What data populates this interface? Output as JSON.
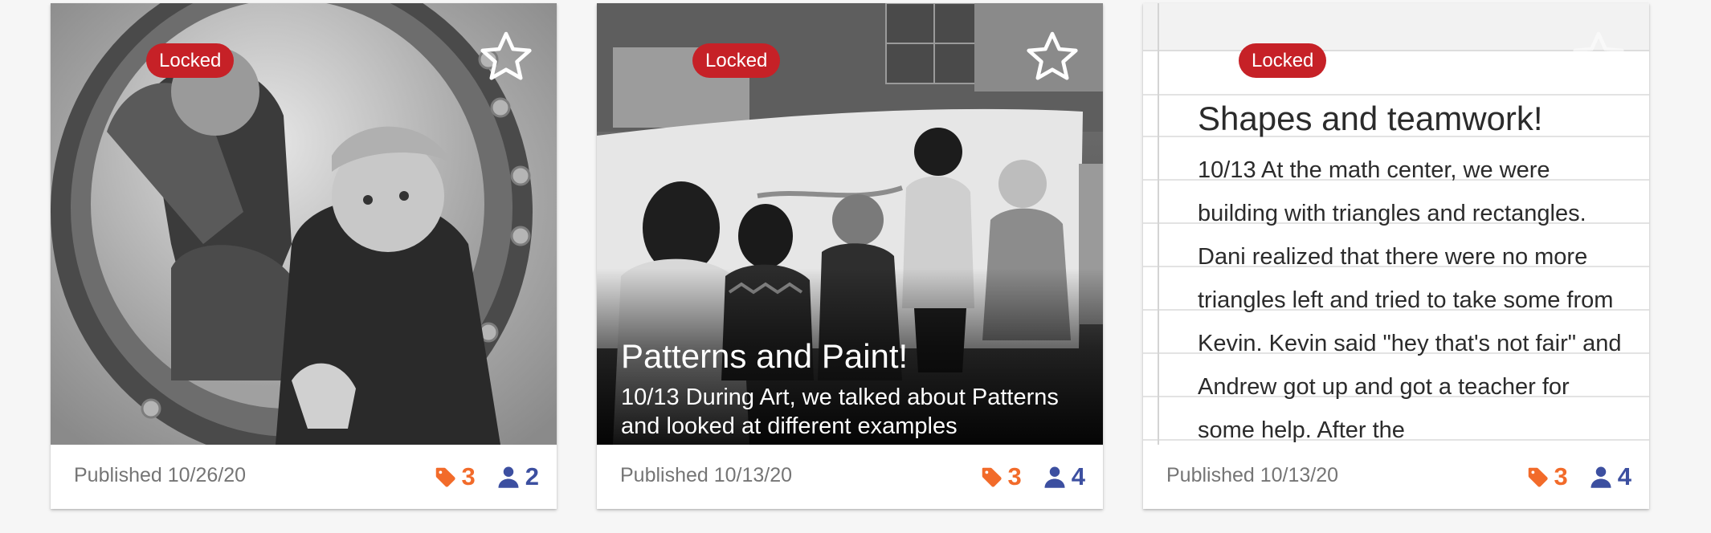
{
  "colors": {
    "locked_badge": "#c62127",
    "tag_accent": "#f26b2a",
    "people_accent": "#3c4fa0",
    "published_text": "#757575"
  },
  "cards": [
    {
      "locked_label": "Locked",
      "star_icon": "star-outline-icon",
      "published": "Published 10/26/20",
      "tag_count": "3",
      "people_count": "2"
    },
    {
      "locked_label": "Locked",
      "star_icon": "star-outline-icon",
      "title": "Patterns and Paint!",
      "text": "10/13 During Art, we talked about Patterns and looked at different examples",
      "published": "Published 10/13/20",
      "tag_count": "3",
      "people_count": "4"
    },
    {
      "locked_label": "Locked",
      "star_icon": "star-outline-icon",
      "title": "Shapes and teamwork!",
      "text": "10/13 At the math center, we were building with triangles and rectangles. Dani realized that there were no more triangles left and tried to take some from Kevin. Kevin said \"hey that's not fair\" and Andrew got up and got a teacher for some help. After the",
      "published": "Published 10/13/20",
      "tag_count": "3",
      "people_count": "4"
    }
  ]
}
